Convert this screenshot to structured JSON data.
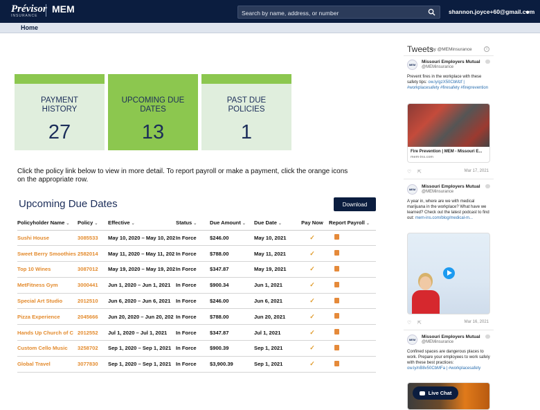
{
  "header": {
    "brand": "Prévisor",
    "brand_sub": "INSURANCE",
    "brand2": "MEM",
    "search_placeholder": "Search by name, address, or number",
    "user": "shannon.joyce+60@gmail.com"
  },
  "nav": {
    "home": "Home"
  },
  "cards": [
    {
      "label_line1": "PAYMENT",
      "label_line2": "HISTORY",
      "value": "27",
      "active": false
    },
    {
      "label_line1": "UPCOMING DUE",
      "label_line2": "DATES",
      "value": "13",
      "active": true
    },
    {
      "label_line1": "PAST DUE",
      "label_line2": "POLICIES",
      "value": "1",
      "active": false
    }
  ],
  "intro": "Click the policy link below to view in more detail. To report payroll or make a payment, click the orange icons on the appropriate row.",
  "section": {
    "title": "Upcoming Due Dates",
    "download_label": "Download"
  },
  "table": {
    "headers": [
      "Policyholder Name",
      "Policy",
      "Effective",
      "Status",
      "Due Amount",
      "Due Date",
      "Pay Now",
      "Report Payroll"
    ],
    "rows": [
      {
        "name": "Sushi House",
        "policy": "3085533",
        "effective": "May 10, 2020 – May 10, 202",
        "status": "In Force",
        "amount": "$246.00",
        "due": "May 10, 2021"
      },
      {
        "name": "Sweet Berry Smoothies",
        "policy": "2582014",
        "effective": "May 11, 2020 – May 11, 202",
        "status": "In Force",
        "amount": "$788.00",
        "due": "May 11, 2021"
      },
      {
        "name": "Top 10 Wines",
        "policy": "3087012",
        "effective": "May 19, 2020 – May 19, 202",
        "status": "In Force",
        "amount": "$347.87",
        "due": "May 19, 2021"
      },
      {
        "name": "MetFitness Gym",
        "policy": "3000441",
        "effective": "Jun 1, 2020 – Jun 1, 2021",
        "status": "In Force",
        "amount": "$900.34",
        "due": "Jun 1, 2021"
      },
      {
        "name": "Special Art Studio",
        "policy": "2012510",
        "effective": "Jun 6, 2020 – Jun 6, 2021",
        "status": "In Force",
        "amount": "$246.00",
        "due": "Jun 6, 2021"
      },
      {
        "name": "Pizza Experience",
        "policy": "2045666",
        "effective": "Jun 20, 2020 – Jun 20, 202",
        "status": "In Force",
        "amount": "$788.00",
        "due": "Jun 20, 2021"
      },
      {
        "name": "Hands Up Church of C",
        "policy": "2012552",
        "effective": "Jul 1, 2020 – Jul 1, 2021",
        "status": "In Force",
        "amount": "$347.87",
        "due": "Jul 1, 2021"
      },
      {
        "name": "Custom Cello Music",
        "policy": "3258702",
        "effective": "Sep 1, 2020 – Sep 1, 2021",
        "status": "In Force",
        "amount": "$900.39",
        "due": "Sep 1, 2021"
      },
      {
        "name": "Global Travel",
        "policy": "3077830",
        "effective": "Sep 1, 2020 – Sep 1, 2021",
        "status": "In Force",
        "amount": "$3,900.39",
        "due": "Sep 1, 2021"
      }
    ]
  },
  "tweets": {
    "title": "Tweets",
    "by": "by @MEMinsurance",
    "items": [
      {
        "name": "Missouri Employers Mutual",
        "handle": "@MEMinsurance",
        "text": "Prevent fires in the workplace with these safety tips:",
        "link": "ow.ly/gzX50CbMzf | #workplacesafety #firesafety #fireprevention",
        "card_title": "Fire Prevention | MEM - Missouri E...",
        "card_src": "mem-ins.com",
        "date": "Mar 17, 2021"
      },
      {
        "name": "Missouri Employers Mutual",
        "handle": "@MEMinsurance",
        "text": "A year in, where are we with medical marijuana in the workplace? What have we learned? Check out the latest podcast to find out:",
        "link": "mem-ins.com/blog/medical-m...",
        "date": "Mar 16, 2021"
      },
      {
        "name": "Missouri Employers Mutual",
        "handle": "@MEMinsurance",
        "text": "Confined spaces are dangerous places to work. Prepare your employees to work safely with these best practices:",
        "link": "ow.ly/nB8v50CbMFa | #workplacesafety"
      }
    ],
    "avatar": "MEM"
  },
  "livechat": "Live Chat"
}
